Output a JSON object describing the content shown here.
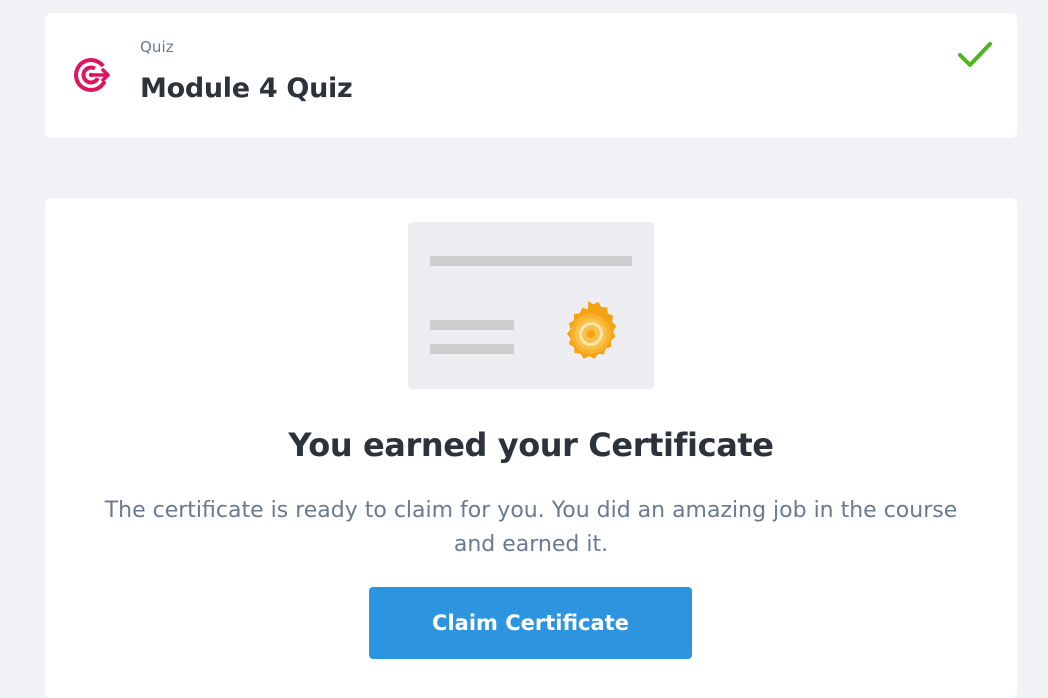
{
  "quiz_card": {
    "kicker": "Quiz",
    "title": "Module 4 Quiz",
    "icon": "target-icon",
    "status_icon": "checkmark-icon",
    "accent_color": "#e0135d",
    "status_color": "#4cb71a"
  },
  "certificate": {
    "heading": "You earned your Certificate",
    "description": "The certificate is ready to claim for you. You did an amazing job in the course and earned it.",
    "claim_label": "Claim Certificate",
    "illustration": "certificate-illustration",
    "seal_icon": "gold-seal-icon",
    "button_color": "#2d95e0"
  }
}
